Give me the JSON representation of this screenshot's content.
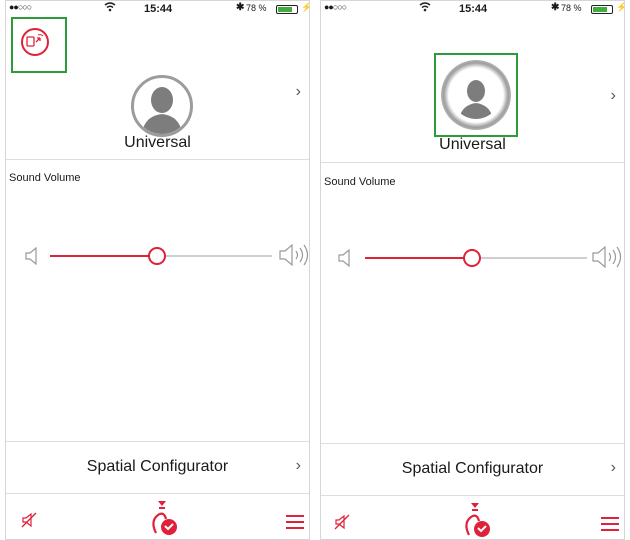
{
  "colors": {
    "accent": "#e0213a",
    "highlight": "#2e9a3a",
    "battery": "#3fae3f"
  },
  "screens": [
    {
      "status": {
        "carrier": "●●○○○",
        "time": "15:44",
        "bluetooth": "✱",
        "battery_text": "78 %",
        "battery_level": 0.78,
        "charging_icon": "bolt-icon"
      },
      "connect_icon": "phone-connect-icon",
      "profile": {
        "name": "Universal",
        "avatar_icon": "person-silhouette-icon",
        "chevron": "›"
      },
      "sound": {
        "label": "Sound Volume",
        "level": 0.48,
        "min_icon": "speaker-mute-icon",
        "max_icon": "speaker-loud-icon"
      },
      "spatial": {
        "label": "Spatial Configurator",
        "chevron": "›"
      },
      "tabbar": {
        "left_icon": "mute-slash-icon",
        "center_icon": "hearing-aid-icon",
        "right_icon": "hamburger-menu-icon"
      }
    },
    {
      "status": {
        "carrier": "●●○○○",
        "time": "15:44",
        "bluetooth": "✱",
        "battery_text": "78 %",
        "battery_level": 0.78,
        "charging_icon": "bolt-icon"
      },
      "profile": {
        "name": "Universal",
        "avatar_icon": "person-silhouette-icon",
        "chevron": "›"
      },
      "sound": {
        "label": "Sound Volume",
        "level": 0.48,
        "min_icon": "speaker-mute-icon",
        "max_icon": "speaker-loud-icon"
      },
      "spatial": {
        "label": "Spatial Configurator",
        "chevron": "›"
      },
      "tabbar": {
        "left_icon": "mute-slash-icon",
        "center_icon": "hearing-aid-icon",
        "right_icon": "hamburger-menu-icon"
      }
    }
  ]
}
